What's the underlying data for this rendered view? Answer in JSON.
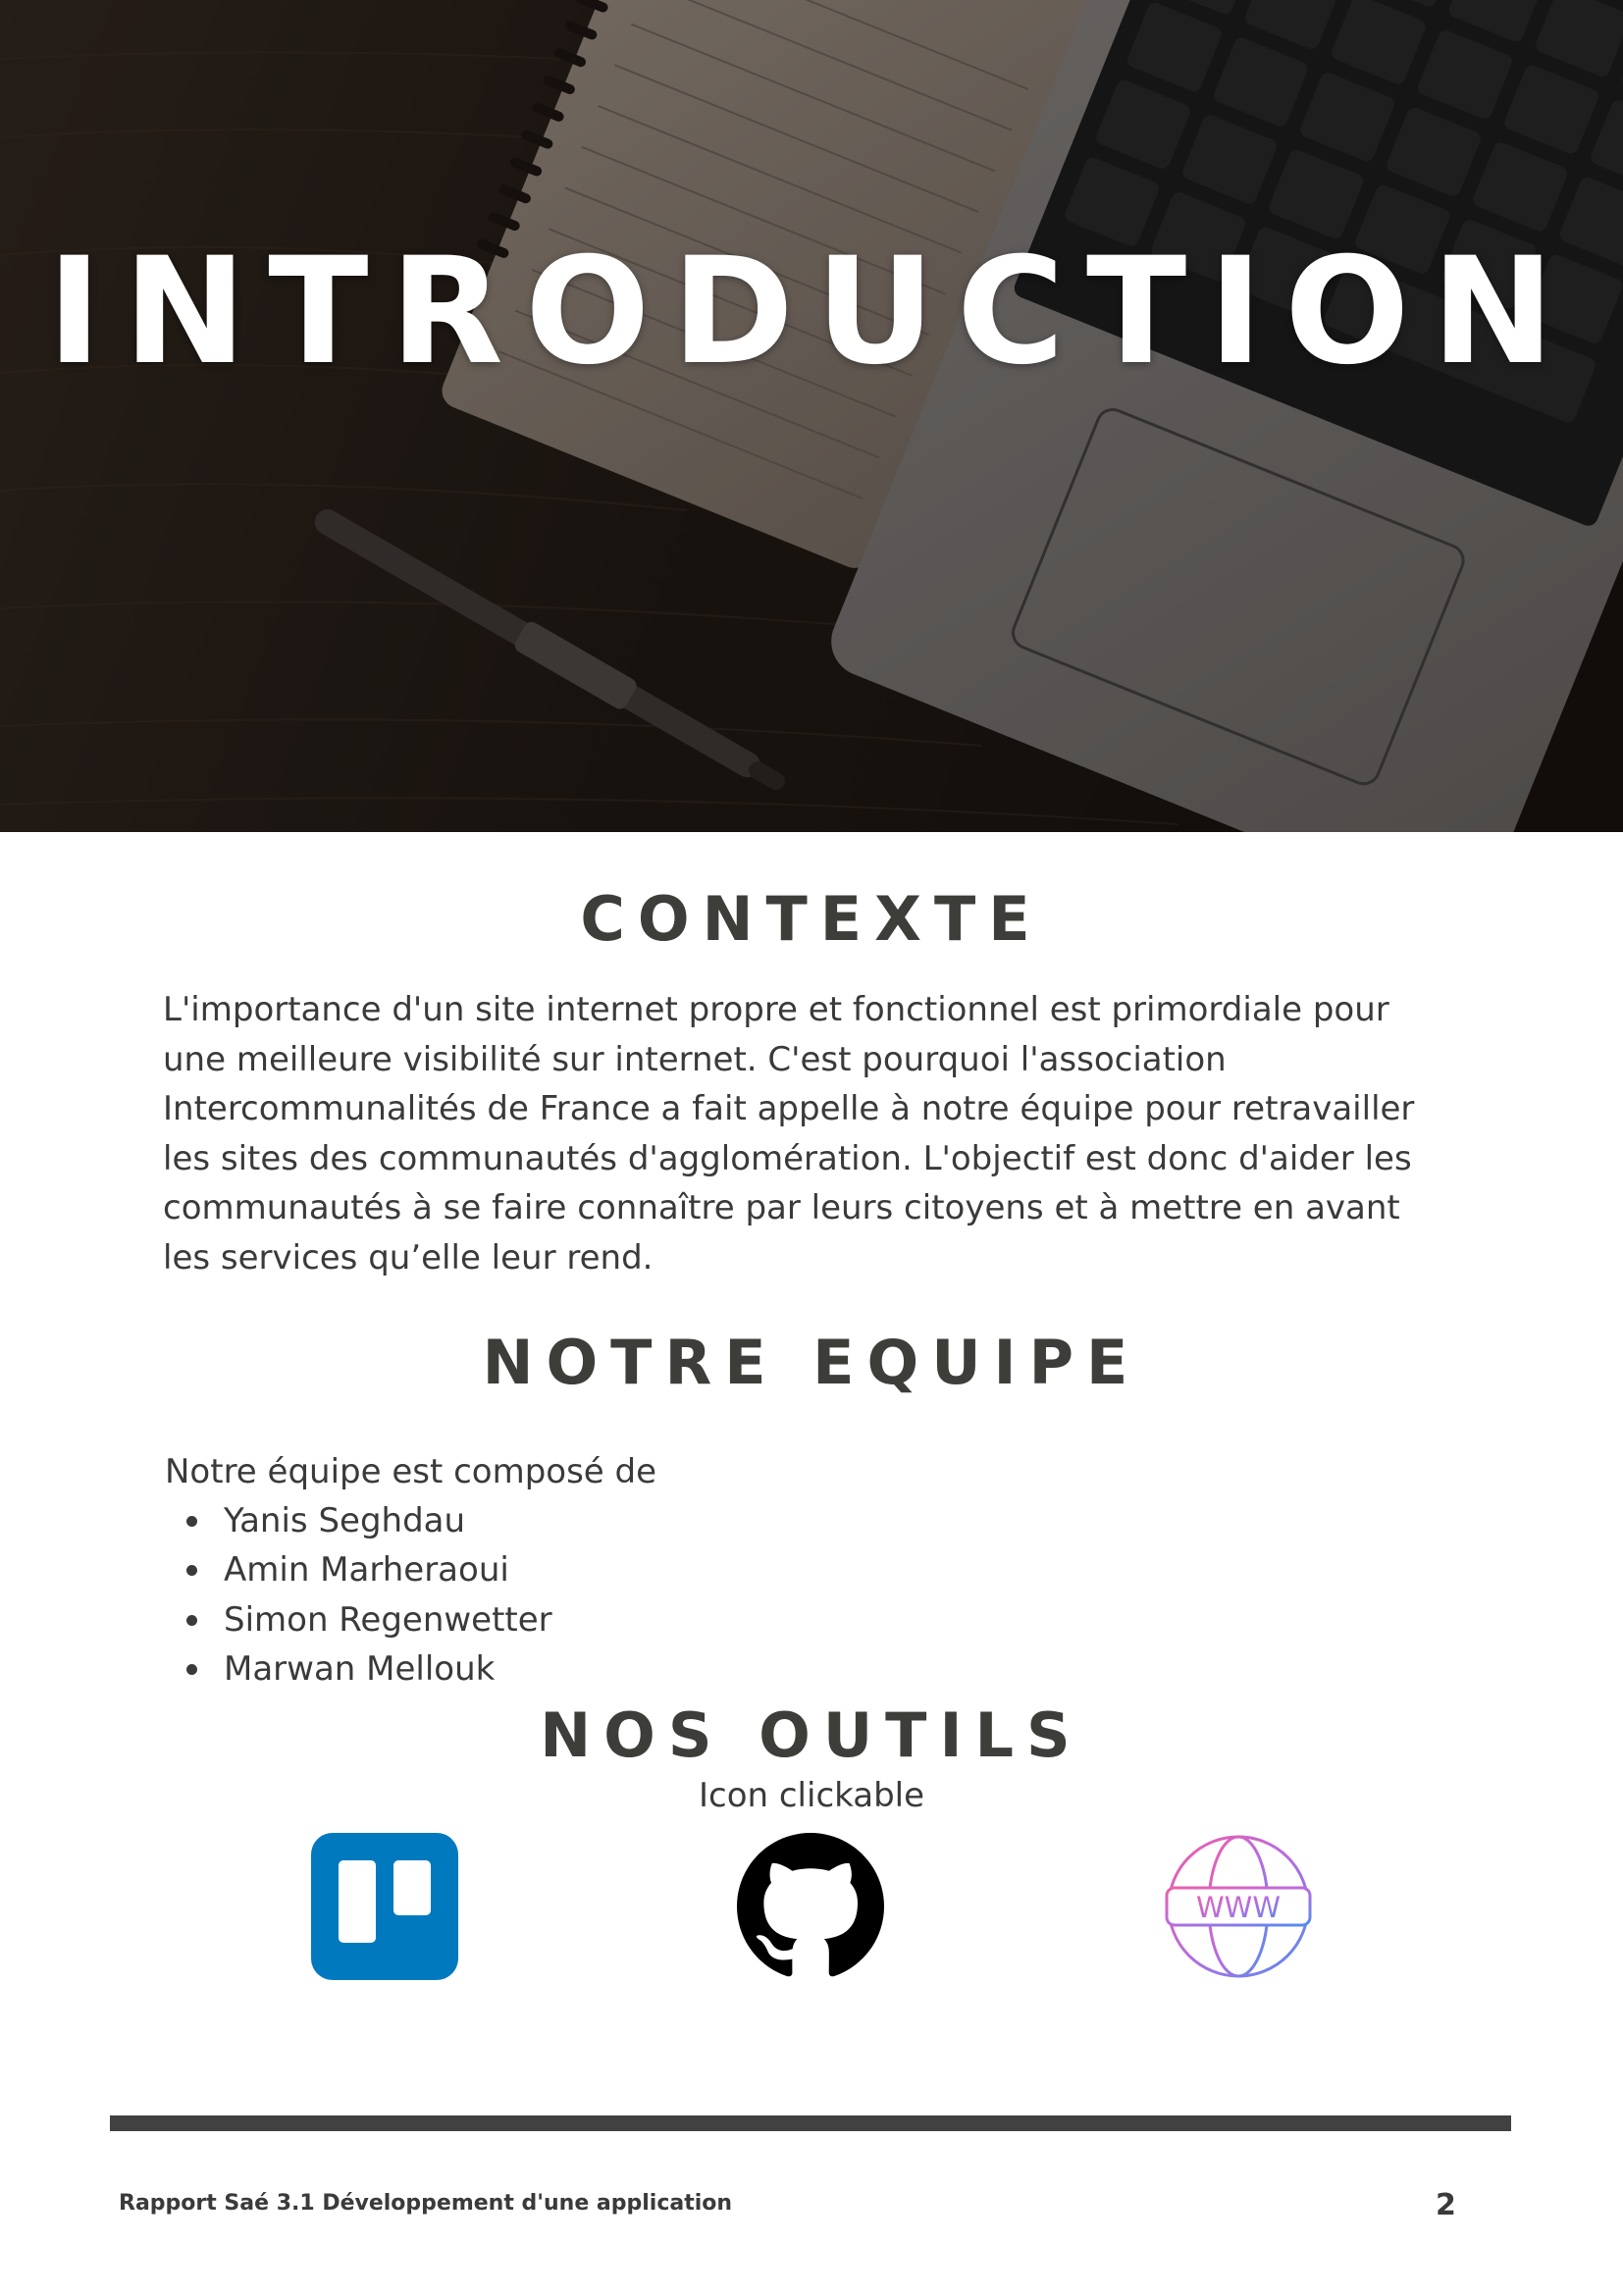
{
  "hero": {
    "title": "INTRODUCTION"
  },
  "sections": {
    "contexte": {
      "title": "CONTEXTE",
      "lines": [
        "L'importance d'un site internet propre et fonctionnel est primordiale pour",
        "une meilleure visibilité sur internet. C'est pourquoi l'association",
        "Intercommunalités de France a fait appelle à notre équipe pour retravailler",
        "les sites des communautés d'agglomération. L'objectif est donc d'aider les",
        "communautés à se faire connaître par leurs citoyens et à mettre en avant",
        "les services qu’elle leur rend."
      ]
    },
    "equipe": {
      "title": "NOTRE EQUIPE",
      "intro": "Notre équipe est composé de",
      "members": [
        "Yanis Seghdau",
        "Amin Marheraoui",
        "Simon Regenwetter",
        "Marwan Mellouk"
      ]
    },
    "outils": {
      "title": "NOS OUTILS",
      "subtitle": "Icon clickable",
      "icons": [
        {
          "name": "trello-icon",
          "color": "#0079BF"
        },
        {
          "name": "github-icon",
          "color": "#000000"
        },
        {
          "name": "www-globe-icon",
          "color": "#b86be0"
        }
      ]
    }
  },
  "footer": {
    "text": "Rapport Saé 3.1 Développement d'une application",
    "page": "2"
  },
  "colors": {
    "heading": "#3d3d3a",
    "text": "#3a3a3a",
    "rule": "#414141"
  }
}
